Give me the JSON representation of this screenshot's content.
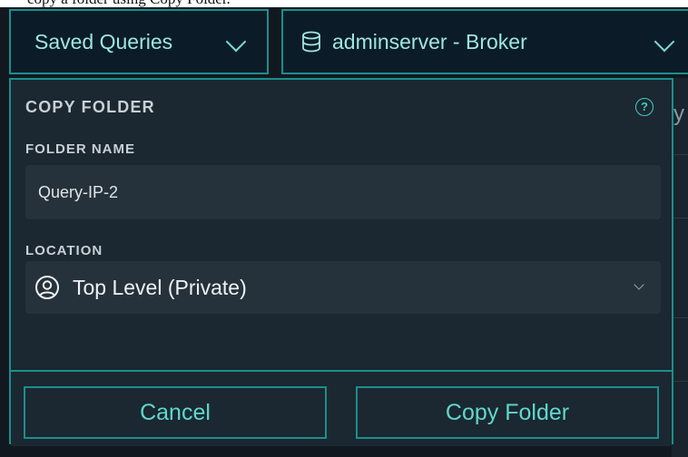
{
  "page": {
    "top_text": "copy a folder using Copy Folder."
  },
  "header": {
    "saved_queries_label": "Saved Queries",
    "server_label": "adminserver - Broker"
  },
  "background": {
    "fragment_text": "y"
  },
  "modal": {
    "title": "COPY FOLDER",
    "help_symbol": "?",
    "folder_name_label": "FOLDER NAME",
    "folder_name_value": "Query-IP-2",
    "location_label": "LOCATION",
    "location_value": "Top Level (Private)",
    "cancel_label": "Cancel",
    "copy_label": "Copy Folder"
  },
  "colors": {
    "accent": "#1b8f8a",
    "accent_text": "#5fd8cc",
    "panel_bg": "#1b2731",
    "input_bg": "#26323b"
  },
  "icons": [
    "chevron-down-icon",
    "database-icon",
    "help-icon",
    "user-circle-icon"
  ]
}
